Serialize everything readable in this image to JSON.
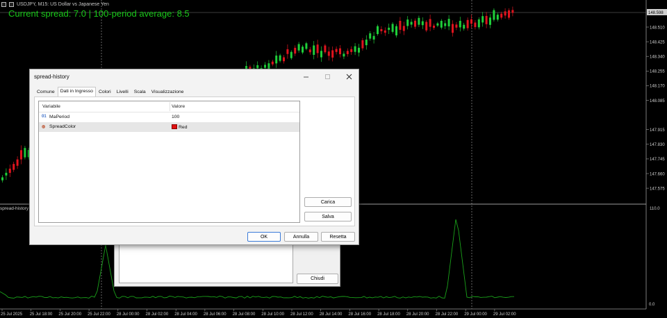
{
  "chart": {
    "symbol": "USDJPY, M15:  US Dollar vs Japanese Yen",
    "spread_text": "Current spread: 7.0 | 100-period average: 8.5",
    "indicator_label": "spread-history 8",
    "current_price": "148.598",
    "price_ticks": [
      "148.510",
      "148.425",
      "148.340",
      "148.255",
      "148.170",
      "148.085",
      "147.915",
      "147.830",
      "147.745",
      "147.660",
      "147.575"
    ],
    "indicator_ticks": [
      "110.0",
      "0.0"
    ],
    "time_ticks": [
      "25 Jul 2025",
      "25 Jul 18:00",
      "25 Jul 20:00",
      "25 Jul 22:00",
      "28 Jul 00:00",
      "28 Jul 02:00",
      "28 Jul 04:00",
      "28 Jul 06:00",
      "28 Jul 08:00",
      "28 Jul 10:00",
      "28 Jul 12:00",
      "28 Jul 14:00",
      "28 Jul 16:00",
      "28 Jul 18:00",
      "28 Jul 20:00",
      "28 Jul 22:00",
      "29 Jul 00:00",
      "29 Jul 02:00"
    ],
    "colors": {
      "background": "#000000",
      "bull": "#1fcf3a",
      "bear": "#e0141e",
      "spread_line": "#1aa31a",
      "spread_text": "#19c819",
      "grid": "#3a3a3a"
    }
  },
  "back_dialog": {
    "close_label": "Chiudi"
  },
  "dialog": {
    "title": "spread-history",
    "minimize_icon": "minimize-icon",
    "maximize_icon": "maximize-icon",
    "close_icon": "close-icon",
    "tabs": [
      {
        "label": "Comune"
      },
      {
        "label": "Dati in Ingresso"
      },
      {
        "label": "Colori"
      },
      {
        "label": "Livelli"
      },
      {
        "label": "Scala"
      },
      {
        "label": "Visualizzazione"
      }
    ],
    "active_tab": "Dati in Ingresso",
    "table": {
      "col_variable": "Variabile",
      "col_value": "Valore",
      "rows": [
        {
          "icon_text": "01",
          "variable": "MaPeriod",
          "value": "100"
        },
        {
          "icon_text": "◍",
          "variable": "SpreadColor",
          "value": "Red",
          "swatch": "#e01010"
        }
      ]
    },
    "buttons": {
      "load": "Carica",
      "save": "Salva",
      "ok": "OK",
      "cancel": "Annulla",
      "reset": "Resetta"
    }
  }
}
